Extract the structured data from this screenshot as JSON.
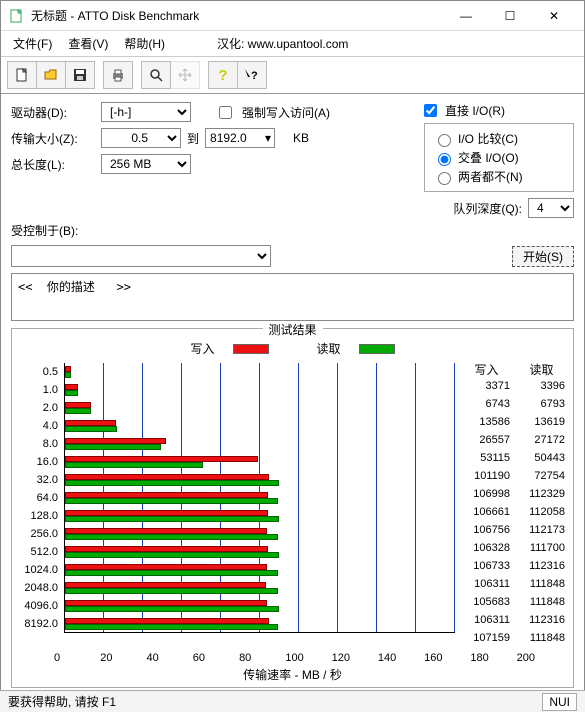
{
  "window": {
    "title": "无标题 - ATTO Disk Benchmark"
  },
  "menu": {
    "file": "文件(F)",
    "view": "查看(V)",
    "help": "帮助(H)",
    "locsite": "汉化: www.upantool.com"
  },
  "labels": {
    "drive": "驱动器(D):",
    "xfersize": "传输大小(Z):",
    "to": "到",
    "kb": "KB",
    "totallen": "总长度(L):",
    "forcewrite": "强制写入访问(A)",
    "directio": "直接 I/O(R)",
    "iocompare": "I/O 比较(C)",
    "overlap": "交叠 I/O(O)",
    "neither": "两者都不(N)",
    "queuedepth": "队列深度(Q):",
    "controlled": "受控制于(B):",
    "start": "开始(S)",
    "results": "测试结果",
    "write": "写入",
    "read": "读取",
    "xaxis": "传输速率 - MB / 秒",
    "desc_prefix": "<<  你的描述   >>",
    "status": "要获得帮助, 请按 F1",
    "status_right": "NUI"
  },
  "values": {
    "drive": "[-h-]",
    "xfer_from": "0.5",
    "xfer_to": "8192.0",
    "totallen": "256 MB",
    "queuedepth": "4",
    "directio_checked": true,
    "mode_selected": "overlap"
  },
  "chart_data": {
    "type": "bar",
    "title": "测试结果",
    "xlabel": "传输速率 - MB / 秒",
    "ylabel": "",
    "xlim": [
      0,
      200
    ],
    "xticks": [
      0,
      20,
      40,
      60,
      80,
      100,
      120,
      140,
      160,
      180,
      200
    ],
    "categories": [
      "0.5",
      "1.0",
      "2.0",
      "4.0",
      "8.0",
      "16.0",
      "32.0",
      "64.0",
      "128.0",
      "256.0",
      "512.0",
      "1024.0",
      "2048.0",
      "4096.0",
      "8192.0"
    ],
    "series": [
      {
        "name": "写入",
        "unit": "KB/s",
        "values": [
          3371,
          6743,
          13586,
          26557,
          53115,
          101190,
          106998,
          106661,
          106756,
          106328,
          106733,
          106311,
          105683,
          106311,
          107159
        ],
        "mb_per_sec": [
          3.3,
          6.6,
          13.3,
          25.9,
          51.9,
          98.8,
          104.5,
          104.2,
          104.3,
          103.8,
          104.2,
          103.8,
          103.2,
          103.8,
          104.6
        ]
      },
      {
        "name": "读取",
        "unit": "KB/s",
        "values": [
          3396,
          6793,
          13619,
          27172,
          50443,
          72754,
          112329,
          112058,
          112173,
          111700,
          112316,
          111848,
          111848,
          112316,
          111848
        ],
        "mb_per_sec": [
          3.3,
          6.6,
          13.3,
          26.5,
          49.3,
          71.0,
          109.7,
          109.4,
          109.5,
          109.1,
          109.7,
          109.2,
          109.2,
          109.7,
          109.2
        ]
      }
    ]
  }
}
